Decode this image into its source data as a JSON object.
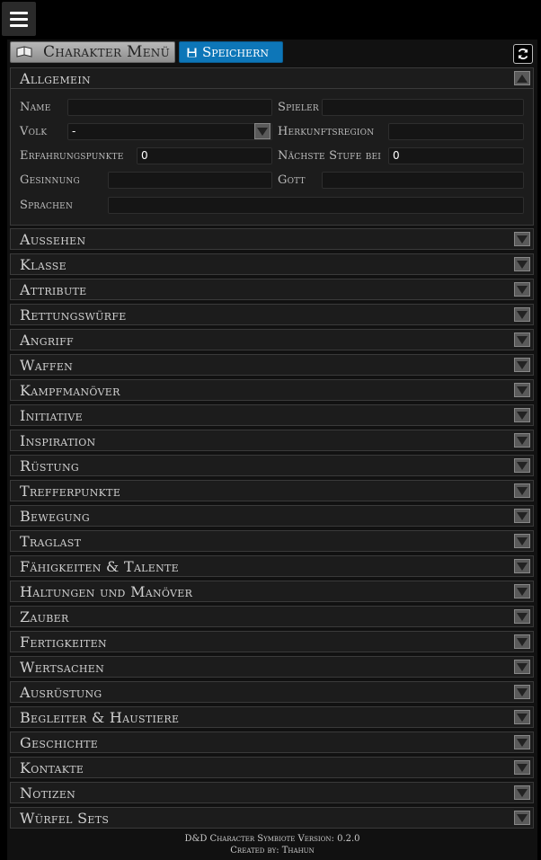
{
  "toolbar": {
    "menu_label": "Charakter Menü",
    "save_label": "Speichern"
  },
  "general": {
    "title": "Allgemein",
    "fields": {
      "name_label": "Name",
      "player_label": "Spieler",
      "race_label": "Volk",
      "race_value": "-",
      "origin_label": "Herkunftsregion",
      "xp_label": "Erfahrungspunkte",
      "xp_value": "0",
      "next_level_label": "Nächste Stufe bei",
      "next_level_value": "0",
      "alignment_label": "Gesinnung",
      "god_label": "Gott",
      "languages_label": "Sprachen"
    }
  },
  "sections": [
    "Aussehen",
    "Klasse",
    "Attribute",
    "Rettungswürfe",
    "Angriff",
    "Waffen",
    "Kampfmanöver",
    "Initiative",
    "Inspiration",
    "Rüstung",
    "Trefferpunkte",
    "Bewegung",
    "Traglast",
    "Fähigkeiten & Talente",
    "Haltungen und Manöver",
    "Zauber",
    "Fertigkeiten",
    "Wertsachen",
    "Ausrüstung",
    "Begleiter & Haustiere",
    "Geschichte",
    "Kontakte",
    "Notizen",
    "Würfel Sets"
  ],
  "footer": {
    "version_line": "D&D Character Symbiote  Version: 0.2.0",
    "credit_line": "Created by: Thahun"
  },
  "icons": {
    "menu": "hamburger-icon",
    "book": "book-icon",
    "save": "floppy-disk-icon",
    "refresh": "refresh-icon",
    "collapse": "triangle-up-icon",
    "expand": "triangle-down-icon"
  },
  "colors": {
    "accent": "#0d76b8",
    "background": "#000000",
    "section": "#1c1c1c"
  }
}
